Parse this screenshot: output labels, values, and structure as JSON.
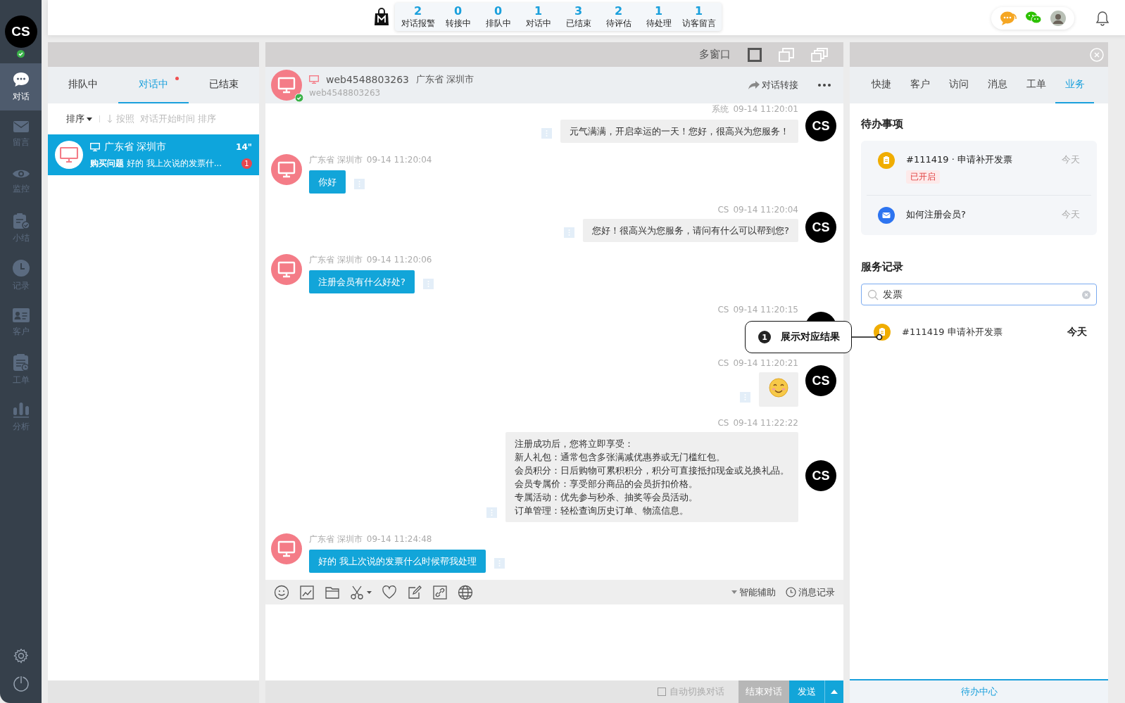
{
  "user": {
    "initials": "CS",
    "online": true
  },
  "nav": [
    {
      "label": "对话",
      "selected": true
    },
    {
      "label": "留言",
      "selected": false
    },
    {
      "label": "监控",
      "selected": false
    },
    {
      "label": "小结",
      "selected": false
    },
    {
      "label": "记录",
      "selected": false
    },
    {
      "label": "客户",
      "selected": false
    },
    {
      "label": "工单",
      "selected": false
    },
    {
      "label": "分析",
      "selected": false
    }
  ],
  "stats": [
    {
      "value": "2",
      "label": "对话报警"
    },
    {
      "value": "0",
      "label": "转接中"
    },
    {
      "value": "0",
      "label": "排队中"
    },
    {
      "value": "1",
      "label": "对话中"
    },
    {
      "value": "3",
      "label": "已结束"
    },
    {
      "value": "2",
      "label": "待评估"
    },
    {
      "value": "1",
      "label": "待处理"
    },
    {
      "value": "1",
      "label": "访客留言"
    }
  ],
  "conversation_list": {
    "tabs": [
      {
        "label": "排队中",
        "selected": false,
        "has_new": false
      },
      {
        "label": "对话中",
        "selected": true,
        "has_new": true
      },
      {
        "label": "已结束",
        "selected": false,
        "has_new": false
      }
    ],
    "sort_label": "排序",
    "sort_hint": "按照  对话开始时间 排序",
    "items": [
      {
        "location": "广东省 深圳市",
        "time": "14\"",
        "category": "购买问题",
        "preview": "好的 我上次说的发票什...",
        "unread": "1",
        "selected": true
      }
    ]
  },
  "chat": {
    "window_mode_label": "多窗口",
    "header": {
      "name": "web4548803263",
      "location": "广东省 深圳市",
      "visitor_id": "web4548803263",
      "online": true,
      "transfer_label": "对话转接"
    },
    "messages": [
      {
        "kind": "sent",
        "sender": "系统",
        "time": "09-14 11:20:01",
        "avatar": "CS",
        "lines": [
          "元气满满，开启幸运的一天！您好，很高兴为您服务！"
        ]
      },
      {
        "kind": "received",
        "sender": "广东省 深圳市",
        "time": "09-14 11:20:04",
        "lines": [
          "你好"
        ]
      },
      {
        "kind": "sent",
        "sender": "CS",
        "time": "09-14 11:20:04",
        "avatar": "CS",
        "lines": [
          "您好！很高兴为您服务，请问有什么可以帮到您?"
        ]
      },
      {
        "kind": "received",
        "sender": "广东省 深圳市",
        "time": "09-14 11:20:06",
        "lines": [
          "注册会员有什么好处?"
        ]
      },
      {
        "kind": "hidden",
        "sender": "CS",
        "time": "09-14 11:20:15"
      },
      {
        "kind": "sticker",
        "sender": "CS",
        "time": "09-14 11:20:21",
        "avatar": "CS"
      },
      {
        "kind": "sent",
        "sender": "CS",
        "time": "09-14 11:22:22",
        "avatar": "CS",
        "lines": [
          "注册成功后，您将立即享受：",
          "新人礼包：通常包含多张满减优惠券或无门槛红包。",
          "会员积分：日后购物可累积积分，积分可直接抵扣现金或兑换礼品。",
          "会员专属价：享受部分商品的会员折扣价格。",
          "专属活动：优先参与秒杀、抽奖等会员活动。",
          "订单管理：轻松查询历史订单、物流信息。"
        ]
      },
      {
        "kind": "received",
        "sender": "广东省 深圳市",
        "time": "09-14 11:24:48",
        "lines": [
          "好的 我上次说的发票什么时候帮我处理"
        ]
      }
    ],
    "toolbar": {
      "assist_label": "智能辅助",
      "history_label": "消息记录"
    },
    "auto_switch": {
      "label": "自动切换对话",
      "checked": false
    },
    "end_button": "结束对话",
    "send_button": "发送"
  },
  "side_panel": {
    "tabs": [
      {
        "label": "快捷",
        "selected": false
      },
      {
        "label": "客户",
        "selected": false
      },
      {
        "label": "访问",
        "selected": false
      },
      {
        "label": "消息",
        "selected": false
      },
      {
        "label": "工单",
        "selected": false
      },
      {
        "label": "业务",
        "selected": true
      }
    ],
    "todo_title": "待办事项",
    "todos": [
      {
        "kind": "ticket",
        "title": "#111419 · 申请补开发票",
        "status": "已开启",
        "date": "今天"
      },
      {
        "kind": "message",
        "title": "如何注册会员?",
        "date": "今天"
      }
    ],
    "records_title": "服务记录",
    "search": {
      "value": "发票"
    },
    "records": [
      {
        "kind": "ticket",
        "title": "#111419 申请补开发票",
        "date": "今天"
      }
    ],
    "footer": "待办中心"
  },
  "callout": {
    "number": "1",
    "text": "展示对应结果"
  }
}
